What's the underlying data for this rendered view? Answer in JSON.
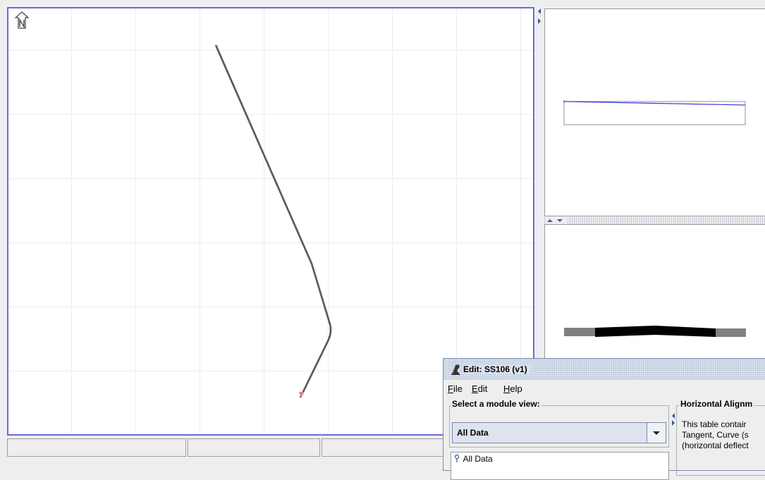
{
  "edit_window": {
    "title": "Edit: SS106 (v1)",
    "menu": {
      "file": "ile",
      "file_key": "F",
      "edit": "dit",
      "edit_key": "E",
      "help": "elp",
      "help_key": "H"
    },
    "module_view_label": "Select a module view:",
    "module_view_value": "All Data",
    "tree_root": "All Data",
    "panel_title": "Horizontal Alignm",
    "panel_text": [
      "This table contair",
      "Tangent, Curve (s",
      "(horizontal deflect"
    ]
  },
  "colors": {
    "plan_border": "#6a6ae0",
    "profile_line": "#3a3ae0",
    "alignment": "#333333"
  },
  "icons": {
    "north": "north-arrow-icon",
    "app": "app-logo-icon"
  }
}
